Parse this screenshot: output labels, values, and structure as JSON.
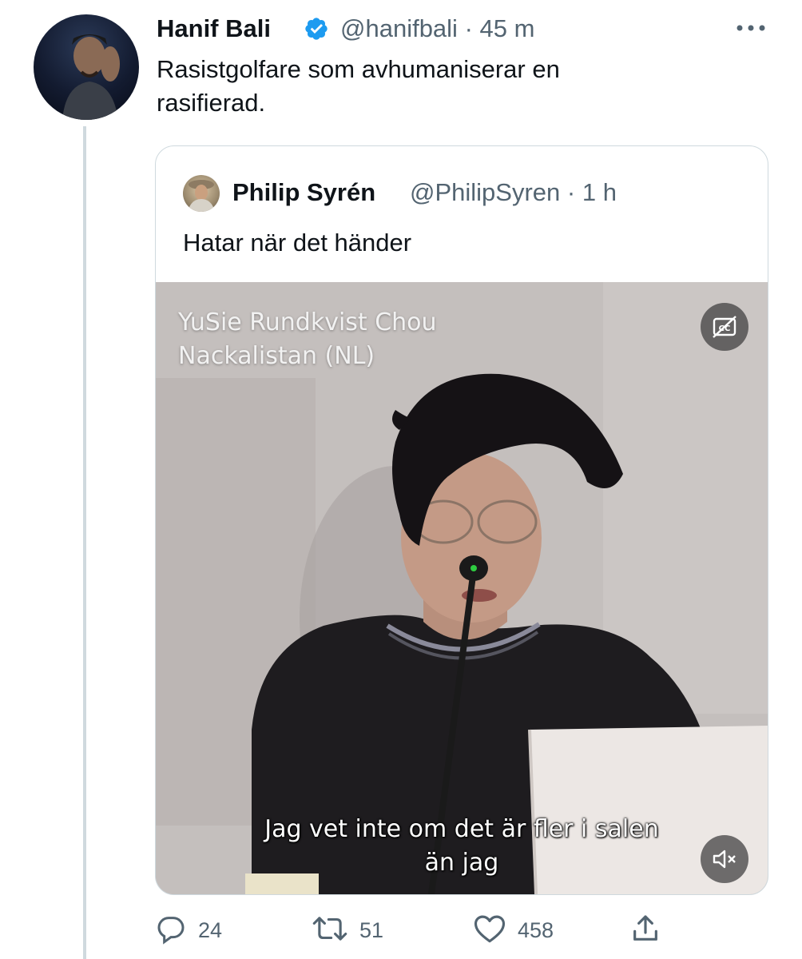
{
  "tweet": {
    "author_name": "Hanif Bali",
    "author_handle": "@hanifbali",
    "separator": "·",
    "time": "45 m",
    "text_line1": "Rasistgolfare som avhumaniserar en",
    "text_line2": "rasifierad.",
    "verified_icon": "verified-badge-icon",
    "more_icon": "more-dots-icon"
  },
  "quote": {
    "author_name": "Philip Syrén",
    "author_handle": "@PhilipSyren",
    "separator": "·",
    "time": "1 h",
    "text": "Hatar när det händer",
    "video": {
      "title_line1": "YuSie Rundkvist Chou",
      "title_line2": "Nackalistan (NL)",
      "subtitle_line1": "Jag vet inte om det är fler i salen",
      "subtitle_line2": "än jag",
      "captions_icon": "captions-off-icon",
      "mute_icon": "muted-speaker-icon"
    }
  },
  "actions": {
    "replies": "24",
    "retweets": "51",
    "likes": "458",
    "reply_icon": "reply-icon",
    "retweet_icon": "retweet-icon",
    "like_icon": "heart-icon",
    "share_icon": "share-icon"
  },
  "colors": {
    "verified": "#1d9bf0",
    "secondary_text": "#536471",
    "border": "#cfd9de"
  }
}
